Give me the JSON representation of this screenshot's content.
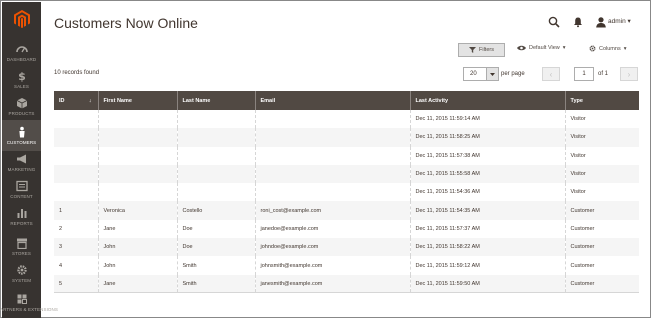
{
  "sidebar": {
    "items": [
      {
        "label": "Dashboard",
        "icon": "dashboard-icon"
      },
      {
        "label": "Sales",
        "icon": "dollar-icon"
      },
      {
        "label": "Products",
        "icon": "cube-icon"
      },
      {
        "label": "Customers",
        "icon": "person-icon",
        "active": true
      },
      {
        "label": "Marketing",
        "icon": "megaphone-icon"
      },
      {
        "label": "Content",
        "icon": "content-icon"
      },
      {
        "label": "Reports",
        "icon": "bar-chart-icon"
      },
      {
        "label": "Stores",
        "icon": "store-icon"
      },
      {
        "label": "System",
        "icon": "gear-icon"
      },
      {
        "label": "Find Partners & Extensions",
        "icon": "partners-icon"
      }
    ]
  },
  "header": {
    "title": "Customers Now Online",
    "user": "admin"
  },
  "toolbar": {
    "filters_label": "Filters",
    "view_label": "Default View",
    "columns_label": "Columns",
    "records_found": "10 records found",
    "per_page_value": "20",
    "per_page_label": "per page",
    "page_value": "1",
    "page_of": "of 1"
  },
  "table": {
    "columns": [
      "ID",
      "First Name",
      "Last Name",
      "Email",
      "Last Activity",
      "Type"
    ],
    "rows": [
      {
        "id": "",
        "first": "",
        "last": "",
        "email": "",
        "activity": "Dec 11, 2015 11:59:14 AM",
        "type": "Visitor"
      },
      {
        "id": "",
        "first": "",
        "last": "",
        "email": "",
        "activity": "Dec 11, 2015 11:58:25 AM",
        "type": "Visitor"
      },
      {
        "id": "",
        "first": "",
        "last": "",
        "email": "",
        "activity": "Dec 11, 2015 11:57:38 AM",
        "type": "Visitor"
      },
      {
        "id": "",
        "first": "",
        "last": "",
        "email": "",
        "activity": "Dec 11, 2015 11:55:58 AM",
        "type": "Visitor"
      },
      {
        "id": "",
        "first": "",
        "last": "",
        "email": "",
        "activity": "Dec 11, 2015 11:54:36 AM",
        "type": "Visitor"
      },
      {
        "id": "1",
        "first": "Veronica",
        "last": "Costello",
        "email": "roni_cost@example.com",
        "activity": "Dec 11, 2015 11:54:35 AM",
        "type": "Customer"
      },
      {
        "id": "2",
        "first": "Jane",
        "last": "Doe",
        "email": "janedoe@example.com",
        "activity": "Dec 11, 2015 11:57:37 AM",
        "type": "Customer"
      },
      {
        "id": "3",
        "first": "John",
        "last": "Doe",
        "email": "johndoe@example.com",
        "activity": "Dec 11, 2015 11:58:22 AM",
        "type": "Customer"
      },
      {
        "id": "4",
        "first": "John",
        "last": "Smith",
        "email": "johnsmith@example.com",
        "activity": "Dec 11, 2015 11:59:12 AM",
        "type": "Customer"
      },
      {
        "id": "5",
        "first": "Jane",
        "last": "Smith",
        "email": "janesmith@example.com",
        "activity": "Dec 11, 2015 11:59:50 AM",
        "type": "Customer"
      }
    ]
  },
  "colors": {
    "sidebar_bg": "#373330",
    "header_row_bg": "#514943",
    "logo_orange": "#eb5202"
  }
}
